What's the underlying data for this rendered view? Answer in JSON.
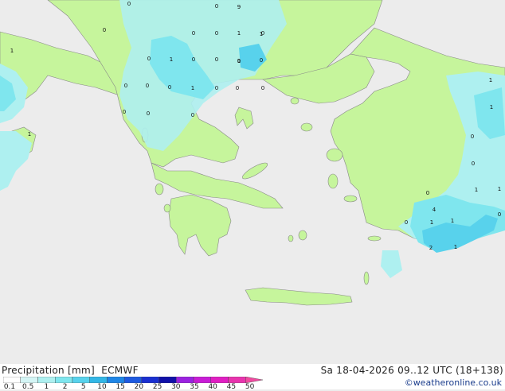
{
  "product": "Precipitation [mm]",
  "model": "ECMWF",
  "timestamp": "Sa 18-04-2026 09..12 UTC (18+138)",
  "credit": "©weatheronline.co.uk",
  "legend": {
    "ticks": [
      "0.1",
      "0.5",
      "1",
      "2",
      "5",
      "10",
      "15",
      "20",
      "25",
      "30",
      "35",
      "40",
      "45",
      "50"
    ],
    "colors": [
      "#ffffff",
      "#d4f5f5",
      "#aef0f0",
      "#7fe6ee",
      "#58d2ec",
      "#33b7e6",
      "#1f86e6",
      "#1e5ae0",
      "#1a2fd0",
      "#1010a8",
      "#9b22e0",
      "#c81cd6",
      "#e01ec2",
      "#e834ae",
      "#f04aa0"
    ]
  },
  "colors": {
    "sea": "#ececec",
    "land": "#c6f59c",
    "light_precip": "#aef0f0",
    "moderate_precip": "#7fe6ee",
    "heavier_precip": "#58d2ec",
    "coast": "#888888"
  },
  "markers": [
    "0",
    "0",
    "9",
    "0",
    "0",
    "0",
    "1",
    "1",
    "0",
    "1",
    "0",
    "0",
    "0",
    "0",
    "0",
    "0",
    "0",
    "0",
    "1",
    "0",
    "0",
    "1",
    "0",
    "0",
    "0",
    "1",
    "1",
    "1",
    "0",
    "0",
    "0",
    "1",
    "0",
    "1",
    "2",
    "1",
    "4",
    "1",
    "1",
    "0",
    "1",
    "0"
  ]
}
